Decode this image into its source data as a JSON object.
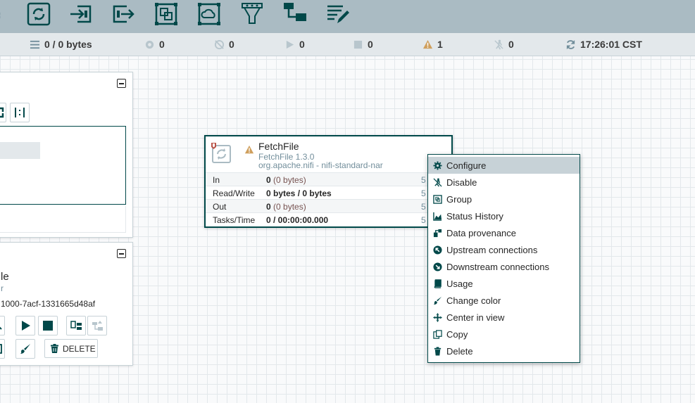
{
  "colors": {
    "toolbar_bg": "#aabbc3",
    "statusbar_bg": "#e3e8eb",
    "icon_dark": "#004849",
    "warning": "#cf9f5d",
    "menu_highlight": "#c7d2d7"
  },
  "toolbar": {
    "icons": [
      "processor-icon",
      "input-port-icon",
      "output-port-icon",
      "process-group-icon",
      "remote-process-group-icon",
      "funnel-icon",
      "template-icon",
      "label-icon"
    ]
  },
  "status": {
    "queued": "0 / 0 bytes",
    "transmitting": "0",
    "not_transmitting": "0",
    "running": "0",
    "stopped": "0",
    "invalid": "1",
    "disabled": "0",
    "refreshed": "17:26:01 CST"
  },
  "operate": {
    "name_fragment": "le",
    "type_fragment": "r",
    "id_fragment": "1000-7acf-1331665d48af",
    "delete_label": "DELETE"
  },
  "processor": {
    "name": "FetchFile",
    "type": "FetchFile 1.3.0",
    "bundle": "org.apache.nifi - nifi-standard-nar",
    "stats": [
      {
        "label": "In",
        "value": "0",
        "detail": "(0 bytes)",
        "window": "5"
      },
      {
        "label": "Read/Write",
        "value": "0 bytes / 0 bytes",
        "detail": "",
        "window": "5"
      },
      {
        "label": "Out",
        "value": "0",
        "detail": "(0 bytes)",
        "window": "5"
      },
      {
        "label": "Tasks/Time",
        "value": "0 / 00:00:00.000",
        "detail": "",
        "window": "5"
      }
    ]
  },
  "context_menu": {
    "items": [
      {
        "label": "Configure",
        "icon": "gear-icon"
      },
      {
        "label": "Disable",
        "icon": "disable-icon"
      },
      {
        "label": "Group",
        "icon": "group-icon"
      },
      {
        "label": "Status History",
        "icon": "chart-icon"
      },
      {
        "label": "Data provenance",
        "icon": "provenance-icon"
      },
      {
        "label": "Upstream connections",
        "icon": "upstream-icon"
      },
      {
        "label": "Downstream connections",
        "icon": "downstream-icon"
      },
      {
        "label": "Usage",
        "icon": "book-icon"
      },
      {
        "label": "Change color",
        "icon": "paintbrush-icon"
      },
      {
        "label": "Center in view",
        "icon": "crosshair-icon"
      },
      {
        "label": "Copy",
        "icon": "copy-icon"
      },
      {
        "label": "Delete",
        "icon": "trash-icon"
      }
    ]
  }
}
